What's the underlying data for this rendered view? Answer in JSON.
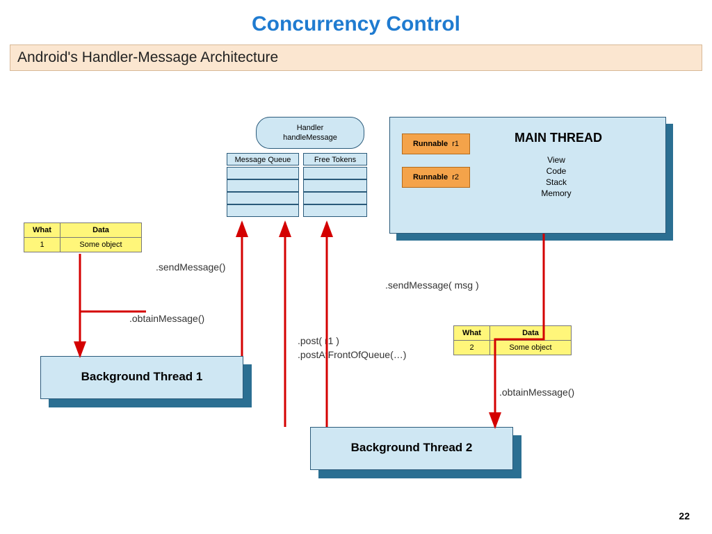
{
  "title": "Concurrency Control",
  "subtitle": "Android's   Handler-Message  Architecture",
  "page_number": "22",
  "handler": {
    "line1": "Handler",
    "line2": "handleMessage"
  },
  "labels": {
    "message_queue": "Message Queue",
    "free_tokens": "Free Tokens"
  },
  "main_thread": {
    "title": "MAIN THREAD",
    "items": [
      "View",
      "Code",
      "Stack",
      "Memory"
    ],
    "runnables": [
      {
        "name": "Runnable",
        "id": "r1"
      },
      {
        "name": "Runnable",
        "id": "r2"
      }
    ]
  },
  "yellow_tables": [
    {
      "headers": [
        "What",
        "Data"
      ],
      "values": [
        "1",
        "Some object"
      ]
    },
    {
      "headers": [
        "What",
        "Data"
      ],
      "values": [
        "2",
        "Some object"
      ]
    }
  ],
  "background_threads": [
    "Background Thread 1",
    "Background Thread 2"
  ],
  "calls": {
    "sendMessage1": ".sendMessage()",
    "sendMessage2": ".sendMessage( msg )",
    "obtainMessage1": ".obtainMessage()",
    "obtainMessage2": ".obtainMessage()",
    "post": ".post( r1 )",
    "postAtFront": ".postAtFrontOfQueue(…)"
  }
}
